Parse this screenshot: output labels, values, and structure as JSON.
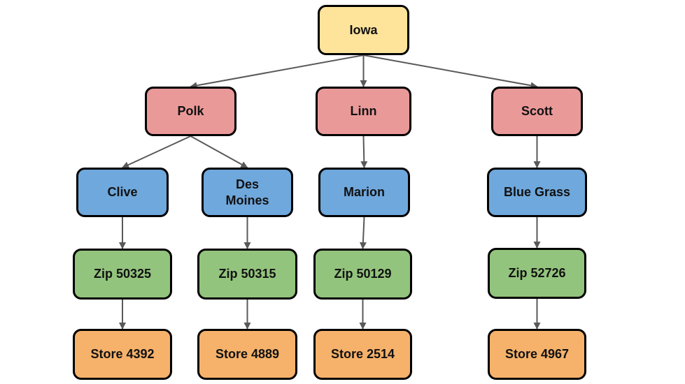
{
  "diagram": {
    "type": "tree",
    "level_colors": {
      "state": "#fde49a",
      "county": "#ea9999",
      "city": "#6fa8dc",
      "zip": "#93c47d",
      "store": "#f6b26b"
    },
    "edge_color": "#595959",
    "nodes": [
      {
        "id": "iowa",
        "label": "Iowa",
        "level": "state"
      },
      {
        "id": "polk",
        "label": "Polk",
        "level": "county"
      },
      {
        "id": "linn",
        "label": "Linn",
        "level": "county"
      },
      {
        "id": "scott",
        "label": "Scott",
        "level": "county"
      },
      {
        "id": "clive",
        "label": "Clive",
        "level": "city"
      },
      {
        "id": "desmoines",
        "label": "Des\nMoines",
        "level": "city"
      },
      {
        "id": "marion",
        "label": "Marion",
        "level": "city"
      },
      {
        "id": "bluegrass",
        "label": "Blue Grass",
        "level": "city"
      },
      {
        "id": "zip50325",
        "label": "Zip 50325",
        "level": "zip"
      },
      {
        "id": "zip50315",
        "label": "Zip 50315",
        "level": "zip"
      },
      {
        "id": "zip50129",
        "label": "Zip 50129",
        "level": "zip"
      },
      {
        "id": "zip52726",
        "label": "Zip 52726",
        "level": "zip"
      },
      {
        "id": "store4392",
        "label": "Store 4392",
        "level": "store"
      },
      {
        "id": "store4889",
        "label": "Store 4889",
        "level": "store"
      },
      {
        "id": "store2514",
        "label": "Store 2514",
        "level": "store"
      },
      {
        "id": "store4967",
        "label": "Store 4967",
        "level": "store"
      }
    ],
    "edges": [
      {
        "from": "iowa",
        "to": "polk"
      },
      {
        "from": "iowa",
        "to": "linn"
      },
      {
        "from": "iowa",
        "to": "scott"
      },
      {
        "from": "polk",
        "to": "clive"
      },
      {
        "from": "polk",
        "to": "desmoines"
      },
      {
        "from": "linn",
        "to": "marion"
      },
      {
        "from": "scott",
        "to": "bluegrass"
      },
      {
        "from": "clive",
        "to": "zip50325"
      },
      {
        "from": "desmoines",
        "to": "zip50315"
      },
      {
        "from": "marion",
        "to": "zip50129"
      },
      {
        "from": "bluegrass",
        "to": "zip52726"
      },
      {
        "from": "zip50325",
        "to": "store4392"
      },
      {
        "from": "zip50315",
        "to": "store4889"
      },
      {
        "from": "zip50129",
        "to": "store2514"
      },
      {
        "from": "zip52726",
        "to": "store4967"
      }
    ]
  }
}
